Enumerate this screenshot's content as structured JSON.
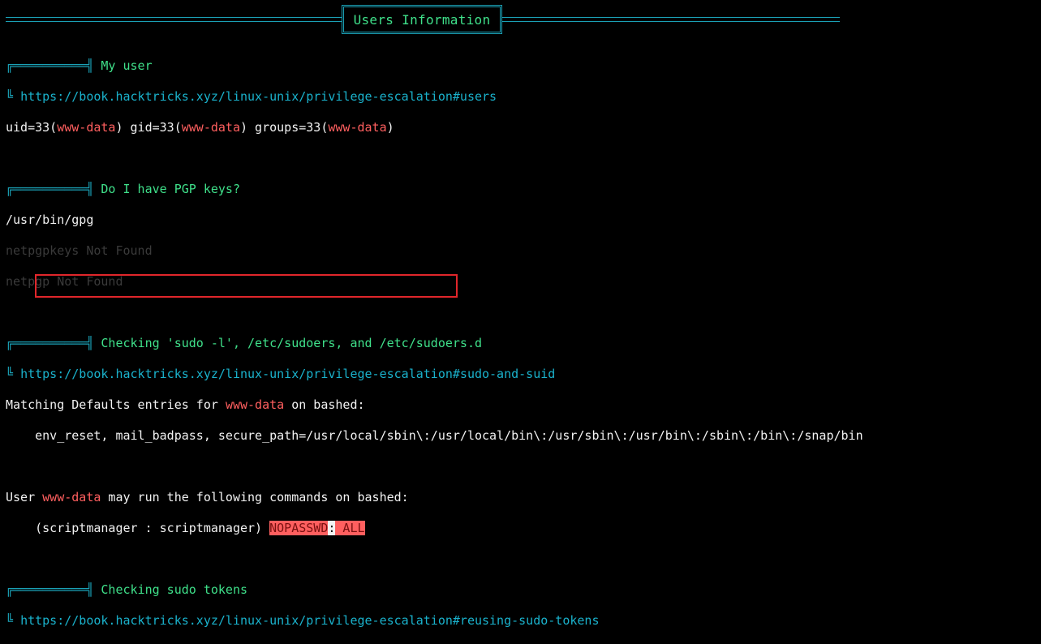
{
  "banner": {
    "title": "Users Information"
  },
  "my_user": {
    "heading_prefix": "╔══════════╣ ",
    "heading": "My user",
    "link_prefix": "╚ ",
    "link": "https://book.hacktricks.xyz/linux-unix/privilege-escalation#users",
    "id_a": "uid=33(",
    "id_user1": "www-data",
    "id_b": ") gid=33(",
    "id_user2": "www-data",
    "id_c": ") groups=33(",
    "id_user3": "www-data",
    "id_d": ")"
  },
  "pgp": {
    "heading_prefix": "╔══════════╣ ",
    "heading": "Do I have PGP keys?",
    "line1": "/usr/bin/gpg",
    "line2": "netpgpkeys Not Found",
    "line3": "netpgp Not Found"
  },
  "sudo": {
    "heading_prefix": "╔══════════╣ ",
    "heading": "Checking 'sudo -l', /etc/sudoers, and /etc/sudoers.d",
    "link_prefix": "╚ ",
    "link": "https://book.hacktricks.xyz/linux-unix/privilege-escalation#sudo-and-suid",
    "defaults_a": "Matching Defaults entries for ",
    "defaults_user": "www-data",
    "defaults_b": " on bashed:",
    "defaults_line": "    env_reset, mail_badpass, secure_path=/usr/local/sbin\\:/usr/local/bin\\:/usr/sbin\\:/usr/bin\\:/sbin\\:/bin\\:/snap/bin",
    "run_a": "User ",
    "run_user": "www-data",
    "run_b": " may run the following commands on bashed:",
    "cmd_indent": "    ",
    "cmd_runas": "(scriptmanager : scriptmanager) ",
    "cmd_nopasswd": "NOPASSWD",
    "cmd_colon": ":",
    "cmd_all": " ALL"
  },
  "tokens": {
    "heading_prefix": "╔══════════╣ ",
    "heading": "Checking sudo tokens",
    "link_prefix": "╚ ",
    "link": "https://book.hacktricks.xyz/linux-unix/privilege-escalation#reusing-sudo-tokens"
  }
}
